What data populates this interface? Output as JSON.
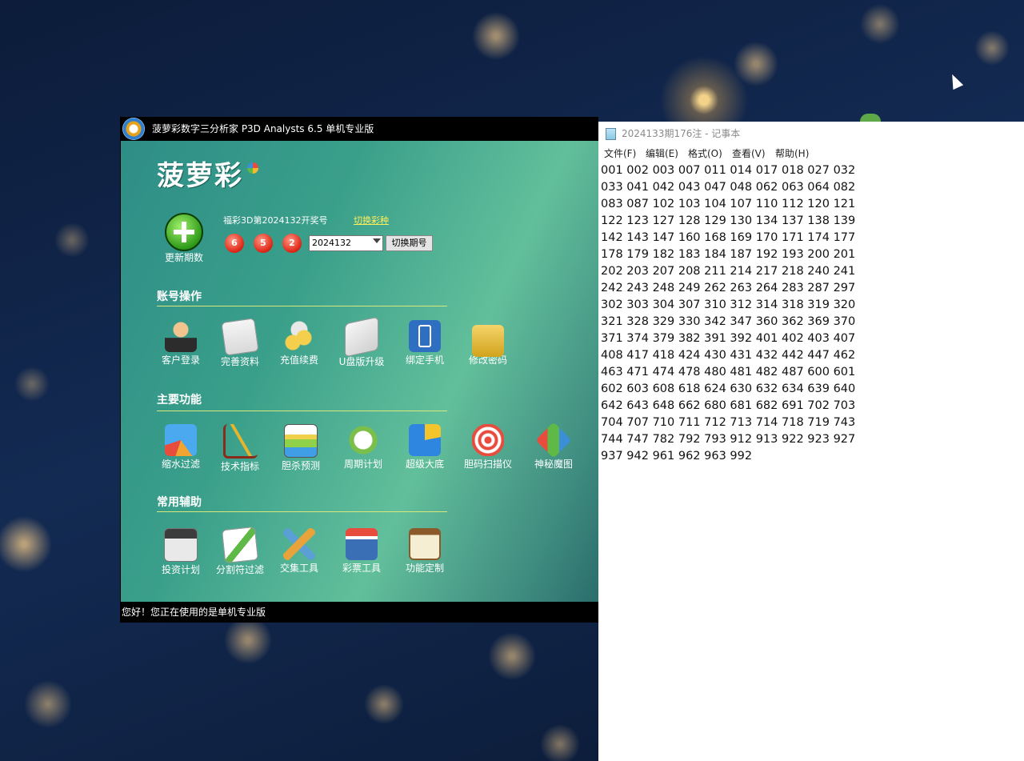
{
  "app": {
    "title": "菠萝彩数字三分析家 P3D Analysts 6.5 单机专业版",
    "brand": "菠萝彩",
    "update_label": "更新期数",
    "draw_title": "福彩3D第2024132开奖号",
    "switch_lottery": "切换彩种",
    "balls": [
      "6",
      "5",
      "2"
    ],
    "period_value": "2024132",
    "switch_period": "切换期号",
    "sections": {
      "account": {
        "title": "账号操作",
        "tools": [
          "客户登录",
          "完善资料",
          "充值续费",
          "U盘版升级",
          "绑定手机",
          "修改密码"
        ]
      },
      "main": {
        "title": "主要功能",
        "tools": [
          "缩水过滤",
          "技术指标",
          "胆杀预测",
          "周期计划",
          "超级大底",
          "胆码扫描仪",
          "神秘魔图"
        ]
      },
      "aux": {
        "title": "常用辅助",
        "tools": [
          "投资计划",
          "分割符过滤",
          "交集工具",
          "彩票工具",
          "功能定制"
        ]
      }
    },
    "status": "您好！您正在使用的是单机专业版"
  },
  "notepad": {
    "title": "2024133期176注 - 记事本",
    "menu": [
      "文件(F)",
      "编辑(E)",
      "格式(O)",
      "查看(V)",
      "帮助(H)"
    ],
    "content": "001 002 003 007 011 014 017 018 027 032\n033 041 042 043 047 048 062 063 064 082\n083 087 102 103 104 107 110 112 120 121\n122 123 127 128 129 130 134 137 138 139\n142 143 147 160 168 169 170 171 174 177\n178 179 182 183 184 187 192 193 200 201\n202 203 207 208 211 214 217 218 240 241\n242 243 248 249 262 263 264 283 287 297\n302 303 304 307 310 312 314 318 319 320\n321 328 329 330 342 347 360 362 369 370\n371 374 379 382 391 392 401 402 403 407\n408 417 418 424 430 431 432 442 447 462\n463 471 474 478 480 481 482 487 600 601\n602 603 608 618 624 630 632 634 639 640\n642 643 648 662 680 681 682 691 702 703\n704 707 710 711 712 713 714 718 719 743\n744 747 782 792 793 912 913 922 923 927\n937 942 961 962 963 992"
  }
}
